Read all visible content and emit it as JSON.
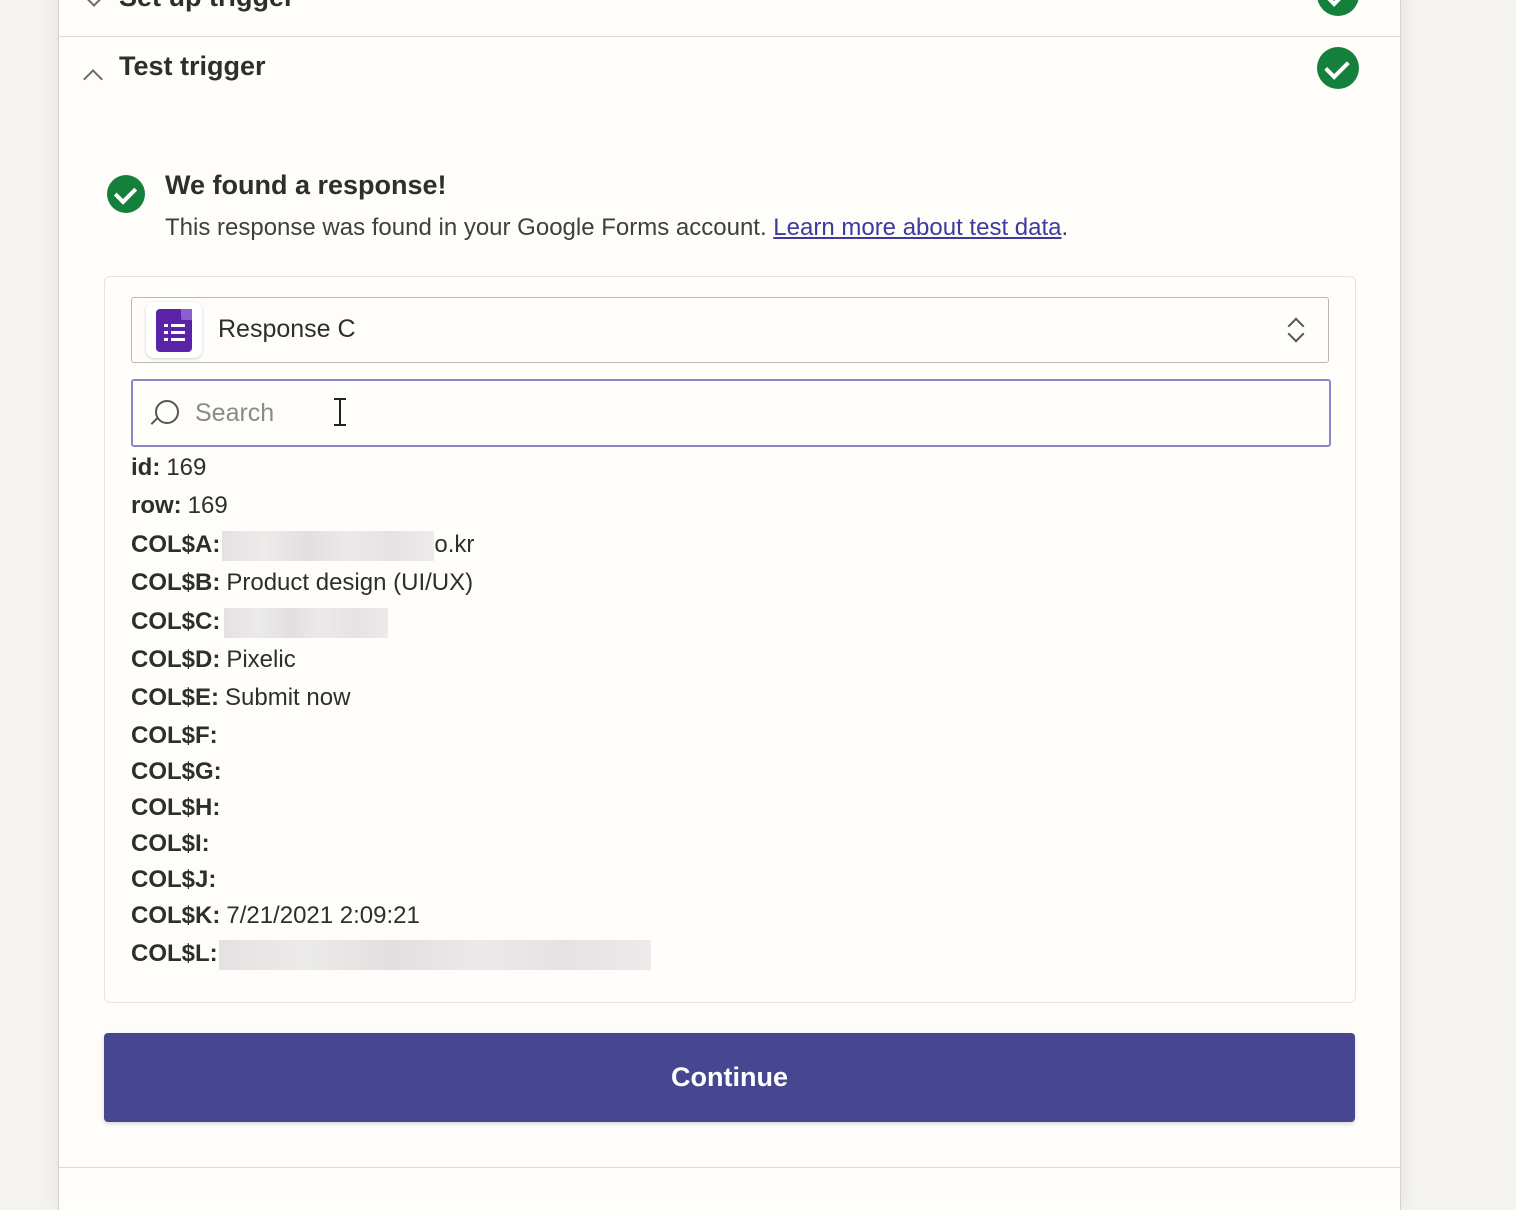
{
  "previous_section": {
    "title": "Set up trigger"
  },
  "section": {
    "title": "Test trigger"
  },
  "result": {
    "heading": "We found a response!",
    "description": "This response was found in your Google Forms account. ",
    "link_text": "Learn more about test data",
    "after_link": "."
  },
  "response_select": {
    "value": "Response C",
    "app_icon": "google-forms-icon"
  },
  "search": {
    "placeholder": "Search",
    "value": ""
  },
  "fields": [
    {
      "key": "id:",
      "value": "169"
    },
    {
      "key": "row:",
      "value": "169"
    },
    {
      "key": "COL$A:",
      "value": "o.kr",
      "redacted": true
    },
    {
      "key": "COL$B:",
      "value": "Product design (UI/UX)"
    },
    {
      "key": "COL$C:",
      "value": "",
      "redacted": true
    },
    {
      "key": "COL$D:",
      "value": "Pixelic"
    },
    {
      "key": "COL$E:",
      "value": "Submit now"
    },
    {
      "key": "COL$F:",
      "value": ""
    },
    {
      "key": "COL$G:",
      "value": ""
    },
    {
      "key": "COL$H:",
      "value": ""
    },
    {
      "key": "COL$I:",
      "value": ""
    },
    {
      "key": "COL$J:",
      "value": ""
    },
    {
      "key": "COL$K:",
      "value": "7/21/2021 2:09:21"
    },
    {
      "key": "COL$L:",
      "value": "",
      "redacted": true
    }
  ],
  "actions": {
    "continue_label": "Continue"
  },
  "colors": {
    "success": "#14803c",
    "primary": "#474791",
    "link": "#3d3aa0",
    "focus_border": "#8a87c9"
  }
}
